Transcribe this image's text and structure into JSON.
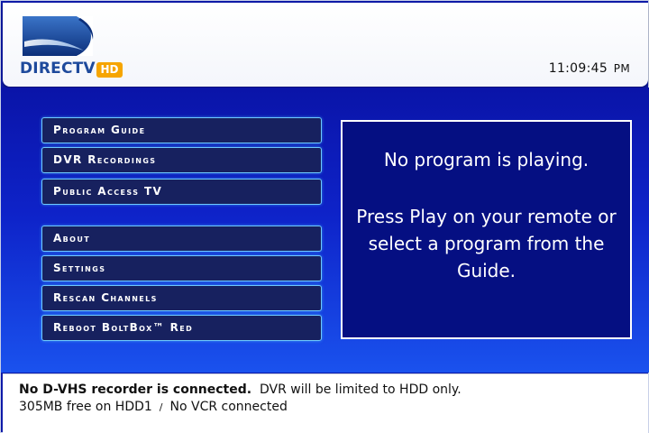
{
  "header": {
    "logo_text": "DIRECTV",
    "logo_badge": "HD",
    "clock_time": "11:09:45",
    "clock_ampm": "PM"
  },
  "menu": {
    "items": [
      {
        "label": "Program Guide"
      },
      {
        "label": "DVR Recordings"
      },
      {
        "label": "Public Access TV"
      },
      {
        "label": "About"
      },
      {
        "label": "Settings"
      },
      {
        "label": "Rescan Channels"
      },
      {
        "label": "Reboot BoltBox™ Red"
      }
    ]
  },
  "info_panel": {
    "line1": "No program is playing.",
    "line2": "Press Play on your remote or select a program from the Guide."
  },
  "status": {
    "line1_bold": "No D-VHS recorder is connected.",
    "line1_rest": "DVR will be limited to HDD only.",
    "line2_left": "305MB free on HDD1",
    "line2_sep": "/",
    "line2_right": "No VCR connected"
  },
  "colors": {
    "background_blue": "#0e1aa8",
    "button_fill": "#17215f",
    "button_border": "#6ec9ff",
    "panel_fill": "#050f82",
    "brand_blue": "#1e4a9c",
    "hd_badge": "#f6a500"
  }
}
